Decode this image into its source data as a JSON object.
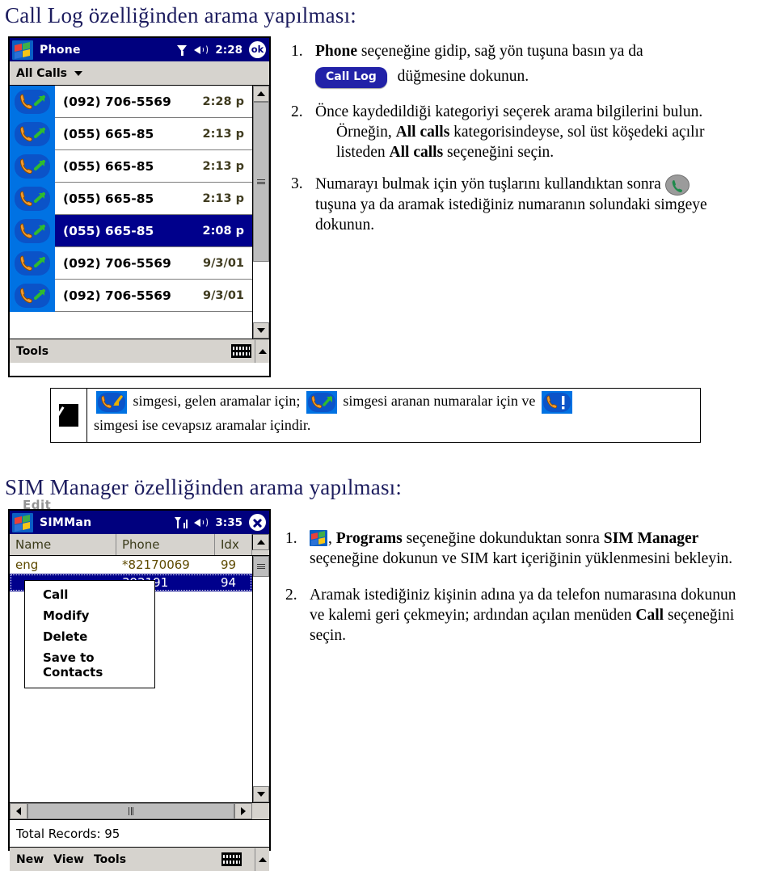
{
  "headings": {
    "call_log": "Call Log özelliğinden arama yapılması:",
    "sim_manager": "SIM Manager özelliğinden arama yapılması:"
  },
  "call_log_device": {
    "title": "Phone",
    "status": {
      "time": "2:28",
      "ok_label": "ok"
    },
    "filter_label": "All Calls",
    "rows": [
      {
        "number": "(092) 706-5569",
        "time": "2:28 p",
        "icon": "outgoing-call-icon",
        "selected": false
      },
      {
        "number": "(055) 665-85",
        "time": "2:13 p",
        "icon": "outgoing-call-icon",
        "selected": false
      },
      {
        "number": "(055) 665-85",
        "time": "2:13 p",
        "icon": "outgoing-call-icon",
        "selected": false
      },
      {
        "number": "(055) 665-85",
        "time": "2:13 p",
        "icon": "outgoing-call-icon",
        "selected": false
      },
      {
        "number": "(055) 665-85",
        "time": "2:08 p",
        "icon": "outgoing-call-icon",
        "selected": true
      },
      {
        "number": "(092) 706-5569",
        "time": "9/3/01",
        "icon": "outgoing-call-icon",
        "selected": false
      },
      {
        "number": "(092) 706-5569",
        "time": "9/3/01",
        "icon": "outgoing-call-icon",
        "selected": false
      }
    ],
    "toolbar": {
      "tools_label": "Tools"
    }
  },
  "call_log_steps": [
    {
      "num": "1.",
      "before": "seçeneğine gidip, sağ yön tuşuna basın ya da",
      "bold_lead": "Phone",
      "pill_label": "Call Log",
      "after": "düğmesine dokunun."
    },
    {
      "num": "2.",
      "line1": "Önce kaydedildiği kategoriyi seçerek arama bilgilerini bulun.",
      "line2_a": "Örneğin,",
      "line2_bold": "All calls",
      "line2_b": "kategorisindeyse, sol üst köşedeki açılır",
      "line3_a": "listeden",
      "line3_bold": "All calls",
      "line3_b": "seçeneğini seçin."
    },
    {
      "num": "3.",
      "line1": "Numarayı bulmak için yön tuşlarını kullandıktan sonra",
      "line2": "tuşuna ya da aramak istediğiniz numaranın solundaki simgeye",
      "line3": "dokunun."
    }
  ],
  "legend": {
    "note_icon": "note-pen-icon",
    "part1": "simgesi, gelen aramalar için;",
    "part2": "simgesi aranan numaralar için ve",
    "part3": "simgesi ise cevapsız aramalar içindir.",
    "icons": [
      "incoming-call-icon",
      "outgoing-call-icon",
      "missed-call-icon"
    ]
  },
  "sim_device": {
    "ghost_label": "Edit",
    "title": "SIMMan",
    "status": {
      "time": "3:35"
    },
    "columns": [
      "Name",
      "Phone",
      "Idx"
    ],
    "rows": [
      {
        "name": "eng",
        "phone": "*82170069",
        "idx": "99",
        "selected": false
      },
      {
        "name": "",
        "phone": "392191",
        "idx": "94",
        "selected": true
      }
    ],
    "context_menu": [
      "Call",
      "Modify",
      "Delete",
      "Save to Contacts"
    ],
    "status_text": "Total Records: 95",
    "toolbar": [
      "New",
      "View",
      "Tools"
    ]
  },
  "sim_steps": [
    {
      "num": "1.",
      "icon": "windows-start-icon",
      "a": ",",
      "bold1": "Programs",
      "b": "seçeneğine dokunduktan sonra",
      "bold2": "SIM Manager",
      "line2": "seçeneğine dokunun ve SIM kart içeriğinin yüklenmesini bekleyin."
    },
    {
      "num": "2.",
      "line1": "Aramak istediğiniz kişinin adına ya da telefon numarasına dokunun",
      "line2_a": "ve kalemi geri çekmeyin; ardından açılan menüden",
      "line2_bold": "Call",
      "line2_b": "seçeneğini",
      "line3": "seçin."
    }
  ],
  "colors": {
    "heading": "#1c1c5e",
    "titlebar": "#00007e",
    "selection": "#00008c",
    "icon_cell": "#0072e3",
    "chrome": "#d6d3ce",
    "pill": "#2222a8"
  }
}
